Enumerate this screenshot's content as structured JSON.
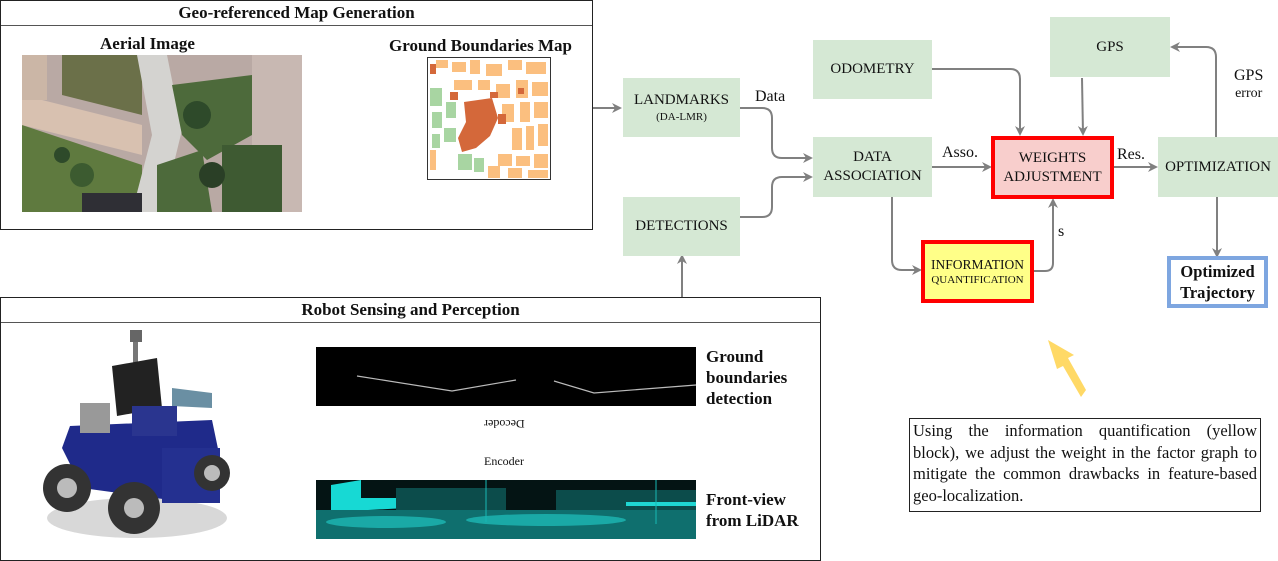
{
  "panels": {
    "map_generation": {
      "title": "Geo-referenced Map Generation",
      "aerial_label": "Aerial Image",
      "map_label": "Ground Boundaries Map"
    },
    "robot_sensing": {
      "title": "Robot Sensing and Perception",
      "boundaries_label_line1": "Ground",
      "boundaries_label_line2": "boundaries",
      "boundaries_label_line3": "detection",
      "lidar_label_line1": "Front-view",
      "lidar_label_line2": "from LiDAR",
      "decoder_label": "Decoder",
      "encoder_label": "Encoder"
    }
  },
  "blocks": {
    "landmarks": {
      "label": "LANDMARKS",
      "sub": "(DA-LMR)"
    },
    "detections": {
      "label": "DETECTIONS"
    },
    "odometry": {
      "label": "ODOMETRY"
    },
    "gps": {
      "label": "GPS"
    },
    "data_association": {
      "line1": "DATA",
      "line2": "ASSOCIATION"
    },
    "weights_adjustment": {
      "line1": "WEIGHTS",
      "line2": "ADJUSTMENT"
    },
    "information_quantification": {
      "line1": "INFORMATION",
      "line2": "QUANTIFICATION"
    },
    "optimization": {
      "label": "OPTIMIZATION"
    },
    "optimized_trajectory": {
      "line1": "Optimized",
      "line2": "Trajectory"
    }
  },
  "edge_labels": {
    "data": "Data",
    "asso": "Asso.",
    "res": "Res.",
    "s": "s",
    "gps_error_line1": "GPS",
    "gps_error_line2": "error"
  },
  "note": {
    "text": "Using the information quantification (yellow block), we adjust the weight in the factor graph to mitigate the common drawbacks in feature-based geo-localization."
  },
  "colors": {
    "green_block": "#d5e8d4",
    "red_border": "#ff0000",
    "weights_fill": "#f8cecc",
    "info_fill": "#ffff88",
    "trajectory_border": "#7ea6e0",
    "arrow": "#808080",
    "hint_arrow": "#ffd966",
    "process_arrow_fill": "#dae8fc",
    "process_arrow_stroke": "#6c8ebf"
  }
}
